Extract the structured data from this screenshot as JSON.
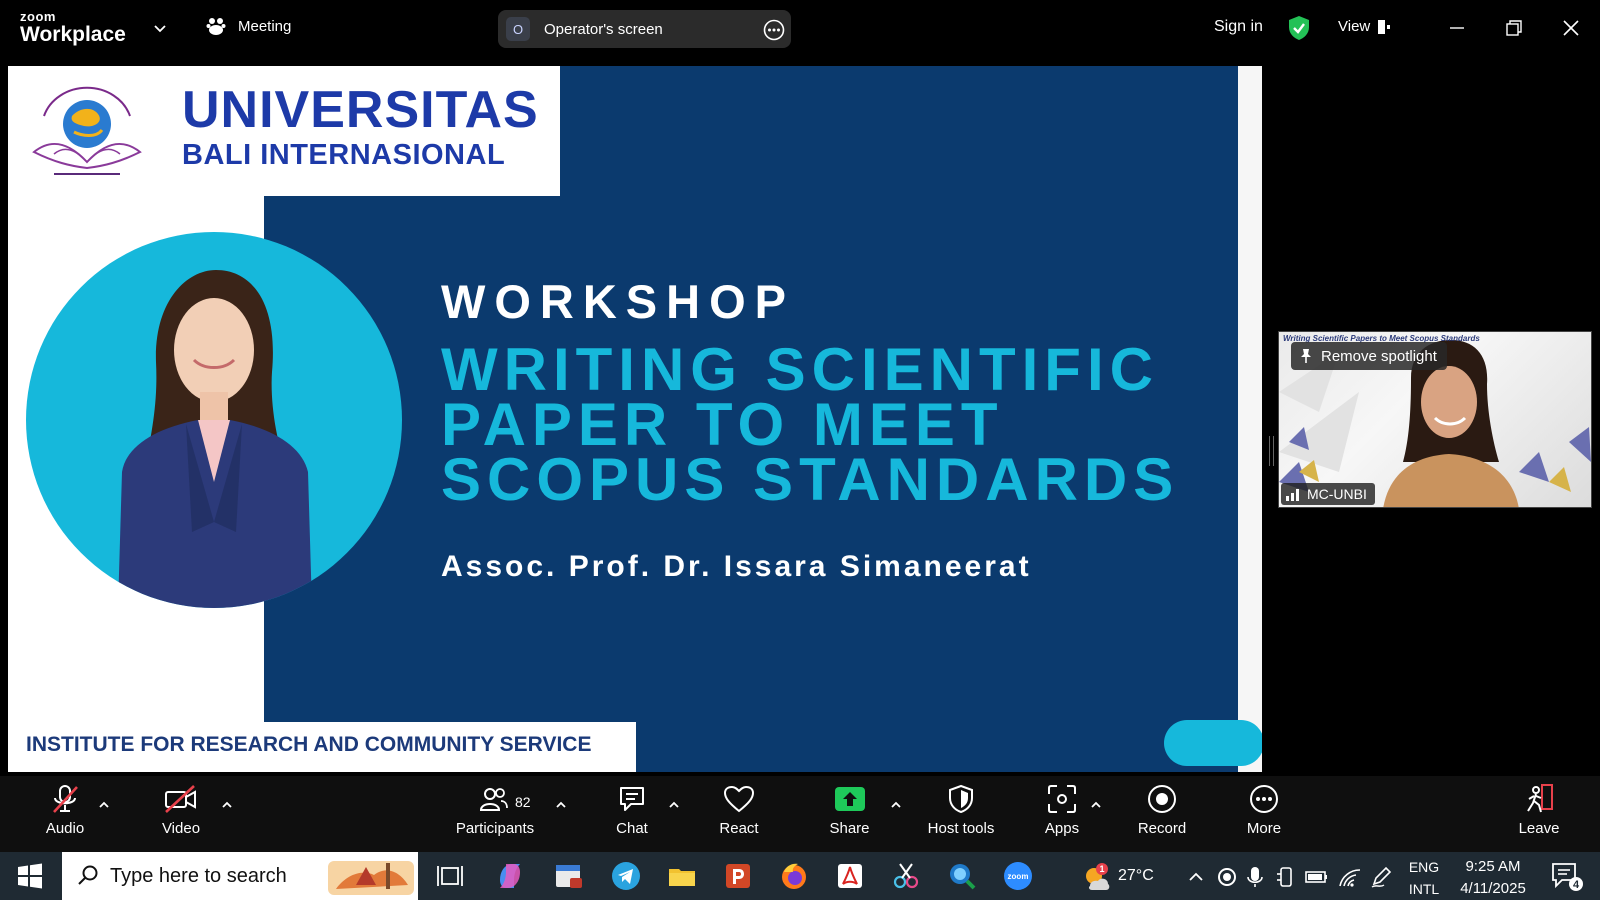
{
  "app": {
    "logo_line1": "zoom",
    "logo_line2": "Workplace",
    "meeting_label": "Meeting",
    "shared_by_initial": "O",
    "shared_by_label": "Operator's screen",
    "sign_in": "Sign in",
    "view_label": "View"
  },
  "slide": {
    "university_name": "UNIVERSITAS",
    "university_sub": "BALI INTERNASIONAL",
    "workshop_label": "WORKSHOP",
    "title_lines": [
      "WRITING SCIENTIFIC",
      "PAPER TO MEET",
      "SCOPUS STANDARDS"
    ],
    "speaker": "Assoc. Prof. Dr. Issara Simaneerat",
    "institute": "INSTITUTE FOR RESEARCH AND COMMUNITY SERVICE"
  },
  "participant_tile": {
    "spotlight_button": "Remove spotlight",
    "name": "MC-UNBI"
  },
  "toolbar": {
    "audio": "Audio",
    "video": "Video",
    "participants": "Participants",
    "participants_count": "82",
    "chat": "Chat",
    "react": "React",
    "share": "Share",
    "host_tools": "Host tools",
    "apps": "Apps",
    "record": "Record",
    "more": "More",
    "leave": "Leave"
  },
  "taskbar": {
    "search_placeholder": "Type here to search",
    "temperature": "27°C",
    "weather_badge": "1",
    "language": "ENG",
    "layout": "INTL",
    "time": "9:25 AM",
    "date": "4/11/2025",
    "notifications": "4"
  },
  "colors": {
    "slide_navy": "#0b3a6e",
    "slide_cyan": "#16b8db",
    "university_blue": "#1d3aa8",
    "share_green": "#1ec95a",
    "mute_red": "#e8414b"
  }
}
